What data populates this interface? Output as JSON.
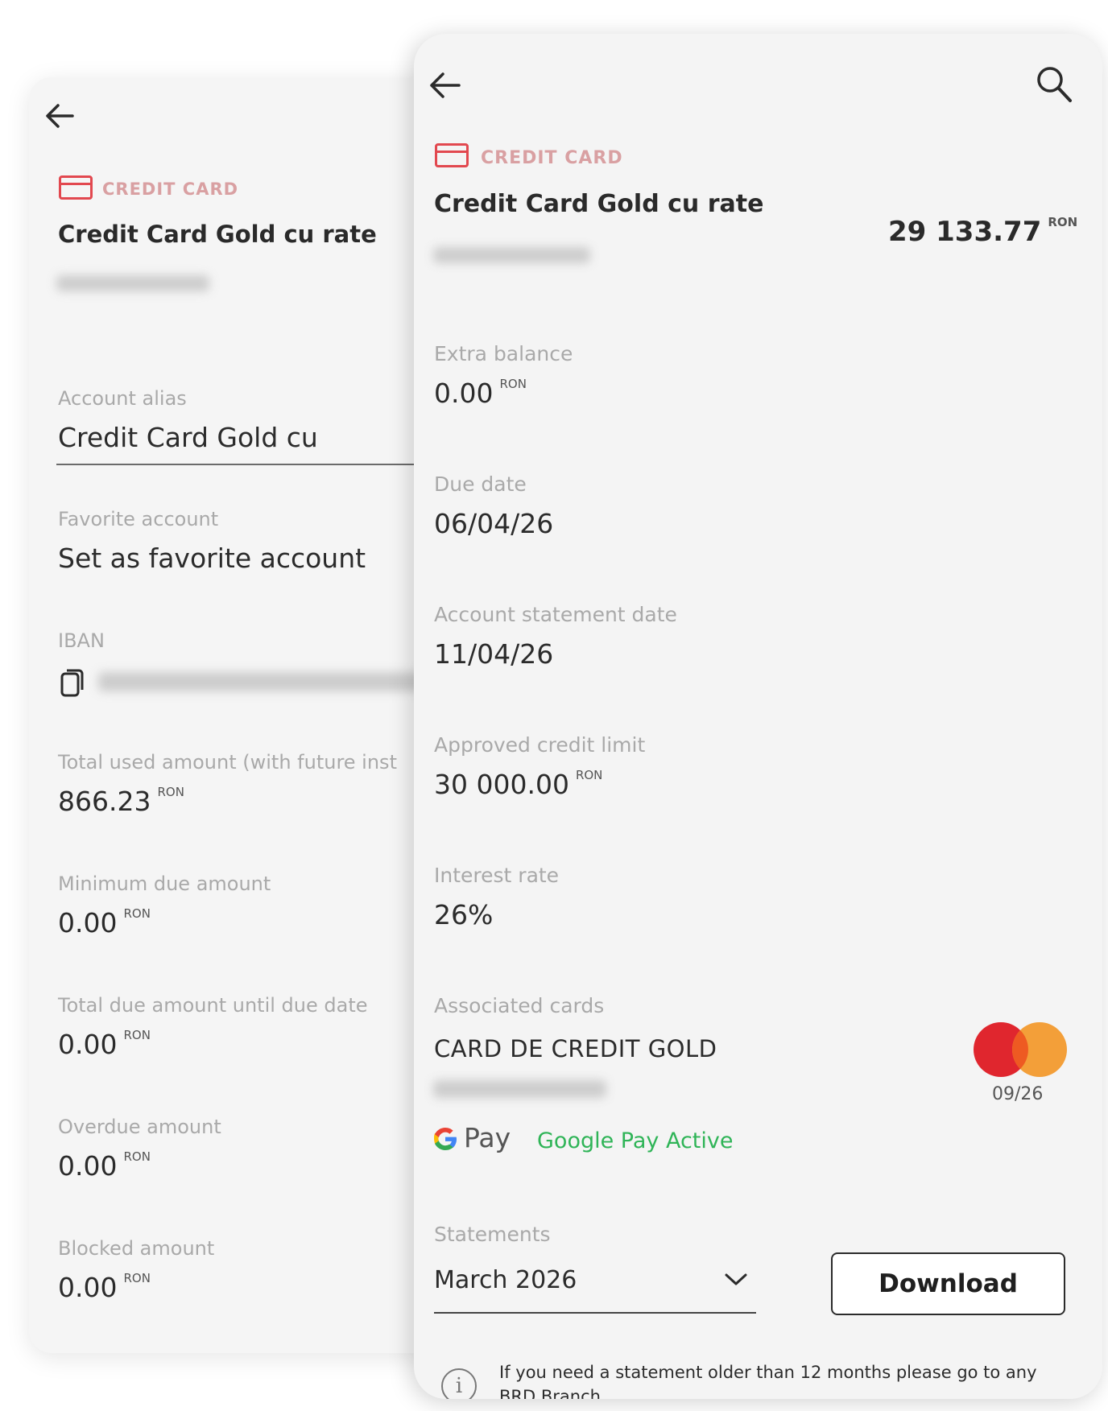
{
  "back_screen": {
    "kind_label": "CREDIT CARD",
    "account_name": "Credit Card Gold cu rate",
    "alias": {
      "label": "Account alias",
      "value": "Credit Card Gold cu"
    },
    "favorite": {
      "label": "Favorite account",
      "value": "Set as favorite account"
    },
    "iban": {
      "label": "IBAN"
    },
    "fields": [
      {
        "label": "Total used amount (with future inst",
        "value": "866.23",
        "unit": "RON"
      },
      {
        "label": "Minimum due amount",
        "value": "0.00",
        "unit": "RON"
      },
      {
        "label": "Total due amount until due date",
        "value": "0.00",
        "unit": "RON"
      },
      {
        "label": "Overdue amount",
        "value": "0.00",
        "unit": "RON"
      },
      {
        "label": "Blocked amount",
        "value": "0.00",
        "unit": "RON"
      }
    ]
  },
  "front_screen": {
    "kind_label": "CREDIT CARD",
    "account_name": "Credit Card Gold cu rate",
    "balance": {
      "value": "29 133.77",
      "unit": "RON"
    },
    "fields": [
      {
        "label": "Extra balance",
        "value": "0.00",
        "unit": "RON"
      },
      {
        "label": "Due date",
        "value": "06/04/26",
        "unit": ""
      },
      {
        "label": "Account statement date",
        "value": "11/04/26",
        "unit": ""
      },
      {
        "label": "Approved credit limit",
        "value": "30 000.00",
        "unit": "RON"
      },
      {
        "label": "Interest rate",
        "value": "26%",
        "unit": ""
      }
    ],
    "associated_cards": {
      "label": "Associated cards",
      "card_name": "CARD DE CREDIT GOLD",
      "expiry": "09/26",
      "gpay_text": "Pay",
      "gpay_status": "Google Pay Active"
    },
    "statements": {
      "label": "Statements",
      "selected_month": "March 2026",
      "download_label": "Download",
      "info_text_line1": "If you need a statement older than 12 months please go to any",
      "info_text_line2": "BRD Branch."
    }
  },
  "colors": {
    "accent_red": "#e2484f",
    "google_pay_green": "#2fb457",
    "mastercard_red": "#e0262e",
    "mastercard_orange": "#f29a2e"
  }
}
